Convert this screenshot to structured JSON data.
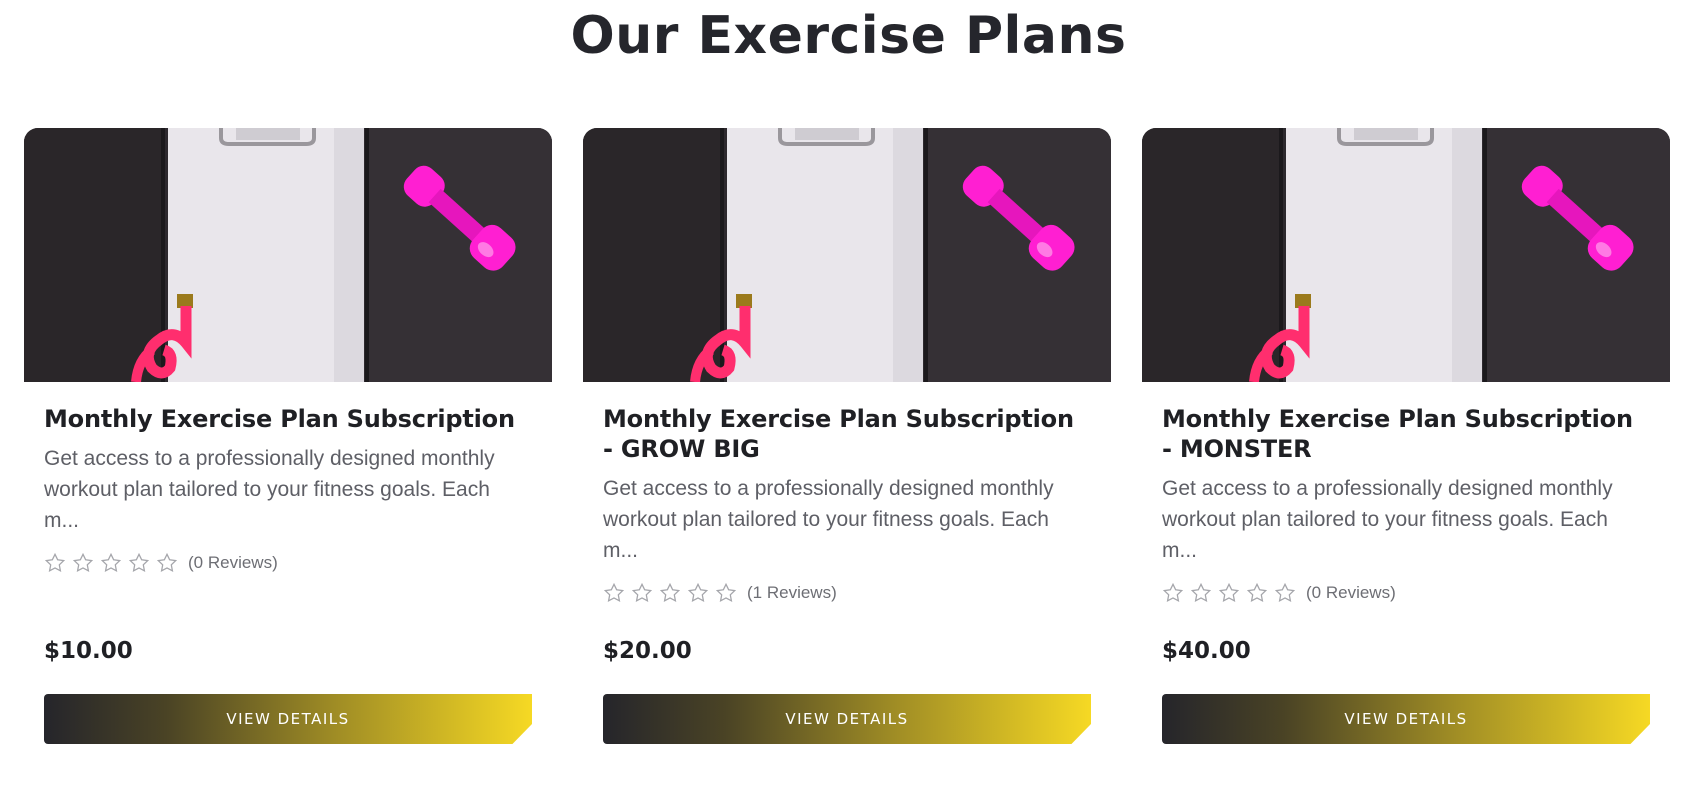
{
  "section": {
    "title": "Our Exercise Plans"
  },
  "cards": [
    {
      "title": "Monthly Exercise Plan Subscription",
      "description": "Get access to a professionally designed monthly workout plan tailored to your fitness goals. Each m...",
      "rating": 0,
      "reviews_label": "(0 Reviews)",
      "price": "$10.00",
      "button_label": "VIEW DETAILS"
    },
    {
      "title": "Monthly Exercise Plan Subscription - GROW BIG",
      "description": "Get access to a professionally designed monthly workout plan tailored to your fitness goals. Each m...",
      "rating": 0,
      "reviews_label": "(1 Reviews)",
      "price": "$20.00",
      "button_label": "VIEW DETAILS"
    },
    {
      "title": "Monthly Exercise Plan Subscription - MONSTER",
      "description": "Get access to a professionally designed monthly workout plan tailored to your fitness goals. Each m...",
      "rating": 0,
      "reviews_label": "(0 Reviews)",
      "price": "$40.00",
      "button_label": "VIEW DETAILS"
    }
  ],
  "colors": {
    "heading": "#25262c",
    "body_text": "#5e5f66",
    "button_start": "#25252b",
    "button_end": "#f6d924",
    "dumbbell": "#ff1fd2",
    "tape": "#ff2e6e"
  },
  "icons": {
    "rating_star": "star-outline-icon",
    "card_image": "clipboard-dumbbell-photo"
  }
}
